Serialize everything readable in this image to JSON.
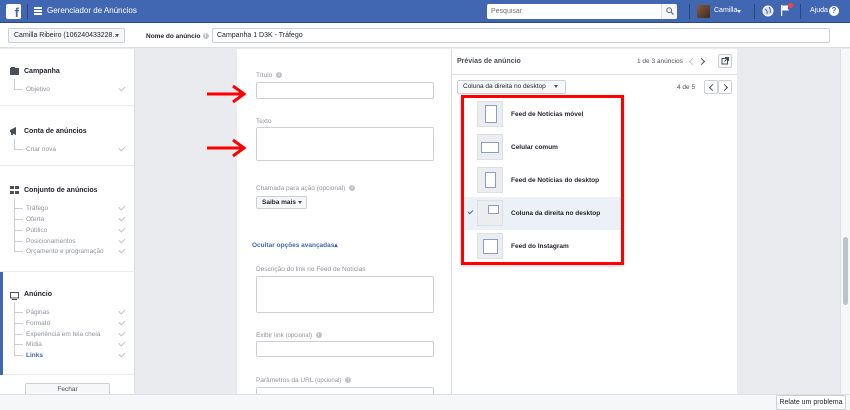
{
  "header": {
    "logo": "f",
    "app_title": "Gerenciador de Anúncios",
    "search_placeholder": "Pesquisar",
    "user_name": "Camilla",
    "help_label": "Ajuda",
    "help_icon": "?",
    "brand_color": "#4267b2"
  },
  "subbar": {
    "account": "Camilla Ribeiro (106240433228...",
    "ad_name_label": "Nome do anúncio",
    "ad_name_value": "Campanha 1 D3K - Tráfego"
  },
  "sidebar": {
    "sections": [
      {
        "title": "Campanha",
        "icon": "campaign-icon",
        "steps": [
          "Objetivo"
        ]
      },
      {
        "title": "Conta de anúncios",
        "icon": "megaphone-icon",
        "steps": [
          "Criar nova"
        ]
      },
      {
        "title": "Conjunto de anúncios",
        "icon": "grid-icon",
        "steps": [
          "Tráfego",
          "Oferta",
          "Público",
          "Posicionamentos",
          "Orçamento e programação"
        ]
      },
      {
        "title": "Anúncio",
        "icon": "monitor-icon",
        "steps": [
          "Páginas",
          "Formato",
          "Experiência em tela cheia",
          "Mídia",
          "Links"
        ]
      }
    ],
    "close_label": "Fechar"
  },
  "form": {
    "title_label": "Título",
    "text_label": "Texto",
    "cta_label": "Chamada para ação (opcional)",
    "cta_value": "Saiba mais",
    "advanced_link": "Ocultar opções avançadas",
    "link_desc_label": "Descrição do link no Feed de Notícias",
    "display_link_label": "Exibir link",
    "display_link_optional": "(opcional)",
    "url_params_label": "Parâmetros da URL",
    "url_params_optional": "(opcional)"
  },
  "preview": {
    "title": "Prévias de anúncio",
    "count": "1 de 3 anúncios",
    "placement": "Coluna da direita no desktop",
    "page_count": "4 de 5",
    "options": [
      {
        "label": "Feed de Notícias móvel",
        "selected": false
      },
      {
        "label": "Celular comum",
        "selected": false
      },
      {
        "label": "Feed de Notícias do desktop",
        "selected": false
      },
      {
        "label": "Coluna da direita no desktop",
        "selected": true
      },
      {
        "label": "Feed do Instagram",
        "selected": false
      }
    ],
    "highlight_color": "#ff0000"
  },
  "footer": {
    "report_label": "Relate um problema"
  }
}
